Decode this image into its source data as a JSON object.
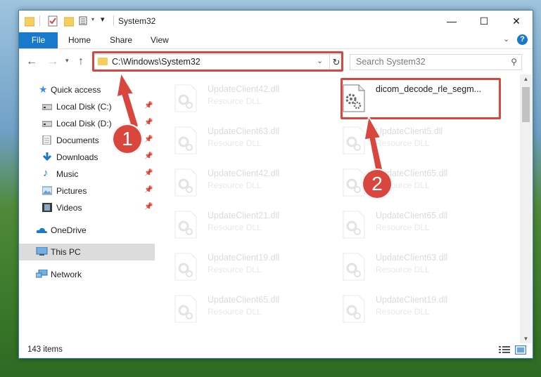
{
  "window": {
    "title": "System32",
    "controls": {
      "minimize": "—",
      "maximize": "☐",
      "close": "✕"
    }
  },
  "ribbon": {
    "tabs": [
      "File",
      "Home",
      "Share",
      "View"
    ],
    "help": "?"
  },
  "navigation": {
    "address_path": "C:\\Windows\\System32",
    "search_placeholder": "Search System32"
  },
  "sidebar": {
    "items": [
      {
        "label": "Quick access",
        "icon": "star-icon",
        "pinned": false
      },
      {
        "label": "Local Disk (C:)",
        "icon": "drive-icon",
        "pinned": true
      },
      {
        "label": "Local Disk (D:)",
        "icon": "drive-icon",
        "pinned": true
      },
      {
        "label": "Documents",
        "icon": "documents-icon",
        "pinned": true
      },
      {
        "label": "Downloads",
        "icon": "downloads-icon",
        "pinned": true
      },
      {
        "label": "Music",
        "icon": "music-icon",
        "pinned": true
      },
      {
        "label": "Pictures",
        "icon": "pictures-icon",
        "pinned": true
      },
      {
        "label": "Videos",
        "icon": "videos-icon",
        "pinned": true
      },
      {
        "label": "OneDrive",
        "icon": "onedrive-icon",
        "pinned": false
      },
      {
        "label": "This PC",
        "icon": "pc-icon",
        "pinned": false,
        "selected": true
      },
      {
        "label": "Network",
        "icon": "network-icon",
        "pinned": false
      }
    ]
  },
  "files": [
    {
      "name": "UpdateClient42.dll",
      "type": "Resource DLL",
      "faded": true
    },
    {
      "name": "dicom_decode_rle_segm...",
      "type": "",
      "faded": false,
      "highlighted": true
    },
    {
      "name": "UpdateClient63.dll",
      "type": "Resource DLL",
      "faded": true
    },
    {
      "name": "UpdateClient5.dll",
      "type": "Resource DLL",
      "faded": true
    },
    {
      "name": "UpdateClient42.dll",
      "type": "Resource DLL",
      "faded": true
    },
    {
      "name": "UpdateClient65.dll",
      "type": "Resource DLL",
      "faded": true
    },
    {
      "name": "UpdateClient21.dll",
      "type": "Resource DLL",
      "faded": true
    },
    {
      "name": "UpdateClient65.dll",
      "type": "Resource DLL",
      "faded": true
    },
    {
      "name": "UpdateClient19.dll",
      "type": "Resource DLL",
      "faded": true
    },
    {
      "name": "UpdateClient63.dll",
      "type": "Resource DLL",
      "faded": true
    },
    {
      "name": "UpdateClient65.dll",
      "type": "Resource DLL",
      "faded": true
    },
    {
      "name": "UpdateClient19.dll",
      "type": "Resource DLL",
      "faded": true
    }
  ],
  "status": {
    "item_count": "143 items"
  },
  "annotations": {
    "step1": "1",
    "step2": "2"
  },
  "colors": {
    "accent": "#1979ca",
    "annotation_red": "#d9463e",
    "selected_bg": "#dcdcdc"
  }
}
